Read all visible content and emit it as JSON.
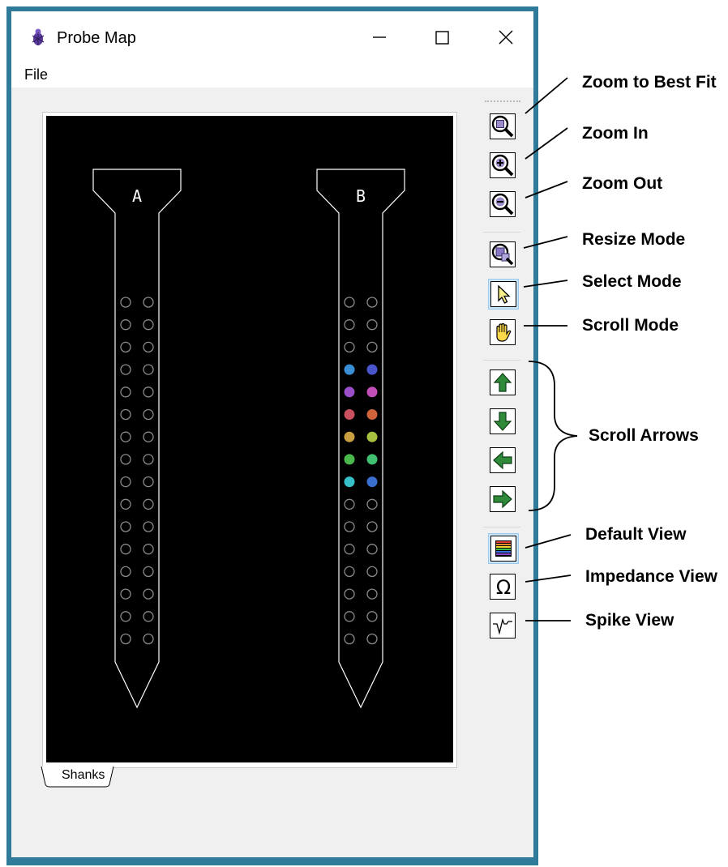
{
  "window": {
    "title": "Probe Map",
    "menu": [
      "File"
    ]
  },
  "map": {
    "tab_label": "Shanks",
    "shanks": [
      {
        "label": "A",
        "electrodes": "32 unassigned (gray outline)"
      },
      {
        "label": "B",
        "electrodes": "32 total, 12 colored"
      }
    ],
    "shank_b_colored": [
      "#3a8fd4",
      "#4a55cc",
      "#9a4ec8",
      "#c24eb8",
      "#c9505f",
      "#d0633a",
      "#c9a040",
      "#a8c040",
      "#4ab84a",
      "#40c070",
      "#38c0c8",
      "#3a6fd0"
    ]
  },
  "toolbar": {
    "buttons": [
      {
        "name": "zoom-best-fit",
        "icon": "magnifier-square-icon"
      },
      {
        "name": "zoom-in",
        "icon": "magnifier-plus-icon"
      },
      {
        "name": "zoom-out",
        "icon": "magnifier-minus-icon"
      },
      {
        "name": "resize-mode",
        "icon": "magnifier-resize-icon"
      },
      {
        "name": "select-mode",
        "icon": "arrow-pointer-icon",
        "active": true
      },
      {
        "name": "scroll-mode",
        "icon": "hand-icon"
      },
      {
        "name": "scroll-up",
        "icon": "arrow-up-icon"
      },
      {
        "name": "scroll-down",
        "icon": "arrow-down-icon"
      },
      {
        "name": "scroll-left",
        "icon": "arrow-left-icon"
      },
      {
        "name": "scroll-right",
        "icon": "arrow-right-icon"
      },
      {
        "name": "default-view",
        "icon": "rainbow-bars-icon",
        "active": true
      },
      {
        "name": "impedance-view",
        "icon": "omega-icon",
        "glyph": "Ω"
      },
      {
        "name": "spike-view",
        "icon": "spike-waveform-icon"
      }
    ]
  },
  "annotations": {
    "zoom_best_fit": "Zoom to Best Fit",
    "zoom_in": "Zoom In",
    "zoom_out": "Zoom Out",
    "resize_mode": "Resize Mode",
    "select_mode": "Select Mode",
    "scroll_mode": "Scroll Mode",
    "scroll_arrows": "Scroll Arrows",
    "default_view": "Default View",
    "impedance_view": "Impedance View",
    "spike_view": "Spike View"
  },
  "colors": {
    "frame": "#2f7b99",
    "map_background": "#000000",
    "electrode_outline": "#8a8a8a",
    "arrow_green": "#2f8a3a",
    "active_button": "#cce4f7"
  }
}
